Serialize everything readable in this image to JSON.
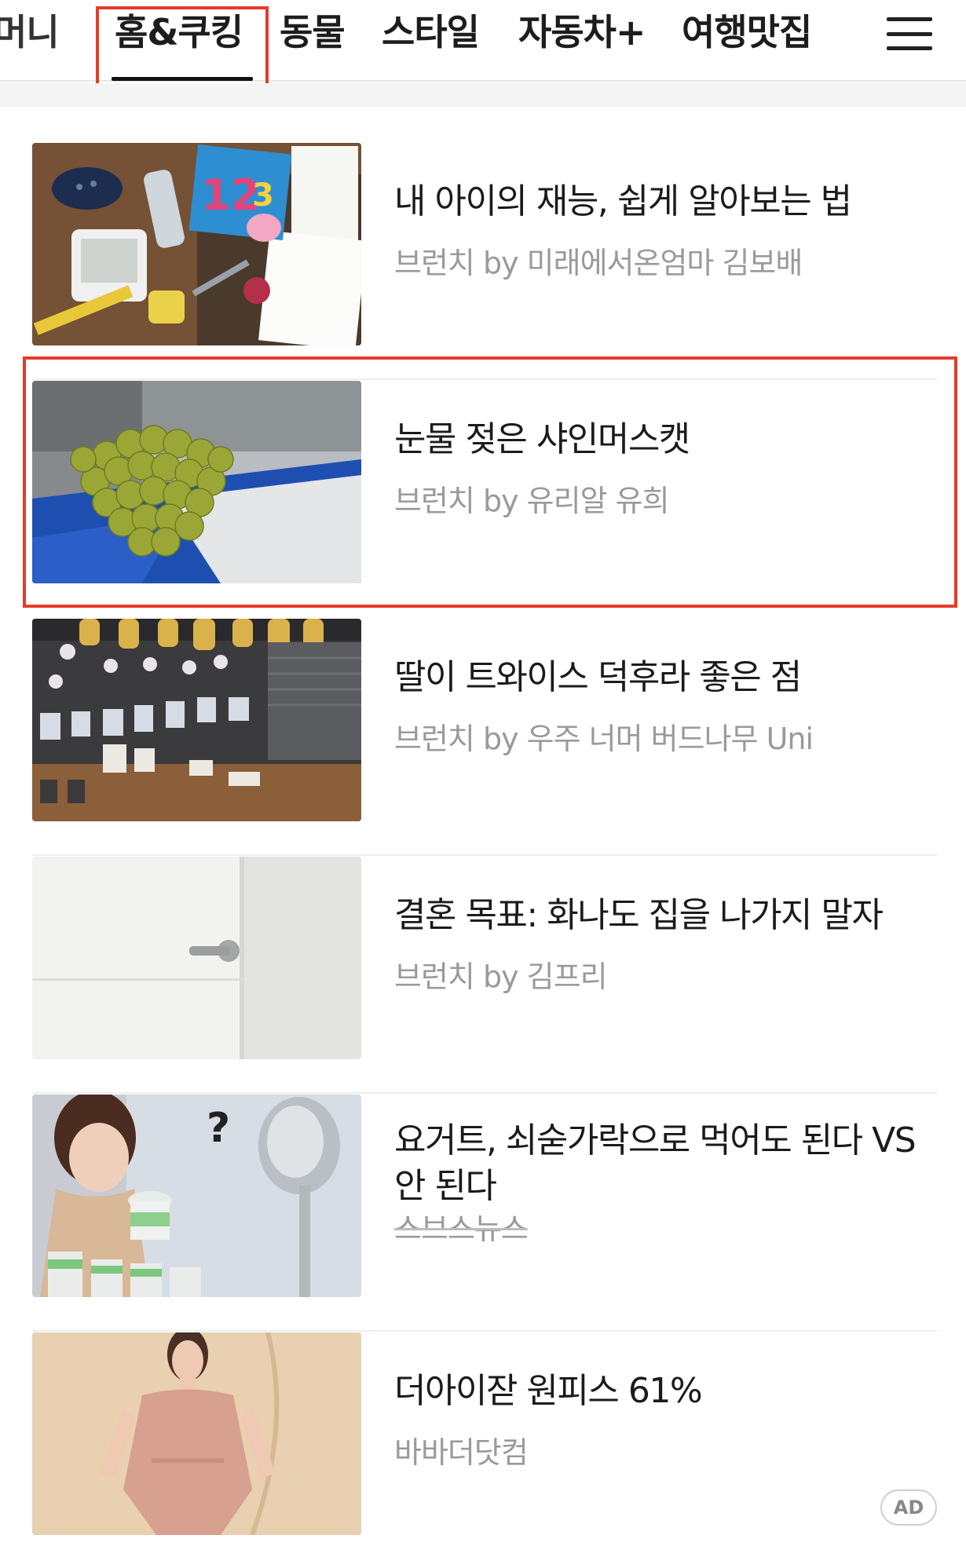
{
  "tabs": {
    "items": [
      {
        "label": "머니"
      },
      {
        "label": "홈&쿠킹",
        "active": true
      },
      {
        "label": "동물"
      },
      {
        "label": "스타일"
      },
      {
        "label": "자동차+"
      },
      {
        "label": "여행맛집"
      }
    ],
    "menu_icon": "hamburger-menu-icon"
  },
  "feed": [
    {
      "title": "내 아이의 재능, 쉽게 알아보는 법",
      "source": "브런치 by 미래에서온엄마 김보배",
      "thumb": "kid-items-photo"
    },
    {
      "title": "눈물 젖은 샤인머스캣",
      "source": "브런치 by 유리알 유희",
      "thumb": "green-grapes-photo"
    },
    {
      "title": "딸이 트와이스 덕후라 좋은 점",
      "source": "브런치 by 우주 너머 버드나무 Uni",
      "thumb": "balloon-party-photo"
    },
    {
      "title": "결혼 목표: 화나도 집을 나가지 말자",
      "source": "브런치 by 김프리",
      "thumb": "white-door-photo"
    },
    {
      "title": "요거트, 쇠숟가락으로 먹어도 된다 VS 안 된다",
      "source": "스브스뉴스",
      "thumb": "yogurt-spoon-photo"
    },
    {
      "title": "더아이잗 원피스 61%",
      "source": "바바더닷컴",
      "ad": "AD",
      "thumb": "pink-dress-photo"
    }
  ],
  "colors": {
    "highlight": "#e53b2c",
    "source_text": "#9a9a9a",
    "divider": "#eeeeee"
  }
}
